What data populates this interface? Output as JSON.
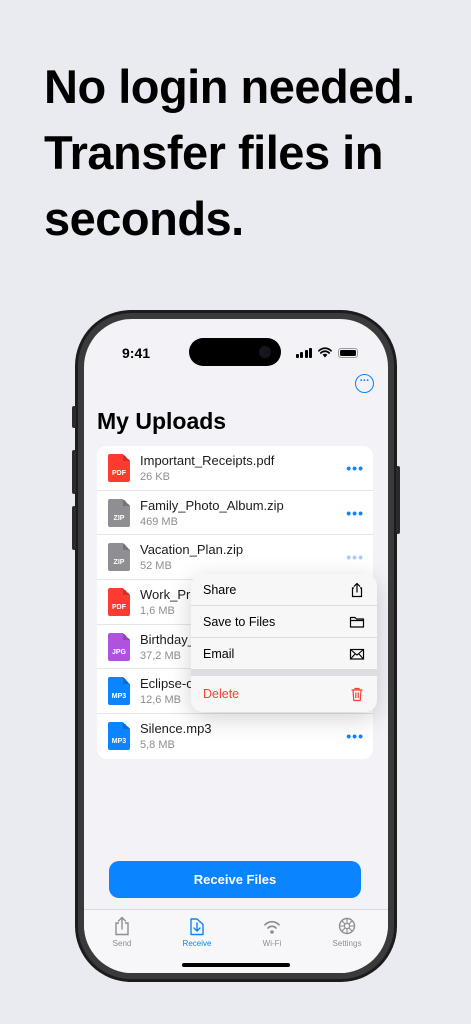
{
  "headline": {
    "line1": "No login needed.",
    "line2": "Transfer files in",
    "line3": "seconds."
  },
  "status_bar": {
    "time": "9:41"
  },
  "page": {
    "title": "My Uploads"
  },
  "files": [
    {
      "name": "Important_Receipts.pdf",
      "size": "26 KB",
      "type": "PDF",
      "color": "#ff3b30"
    },
    {
      "name": "Family_Photo_Album.zip",
      "size": "469 MB",
      "type": "ZIP",
      "color": "#8e8e93"
    },
    {
      "name": "Vacation_Plan.zip",
      "size": "52 MB",
      "type": "ZIP",
      "color": "#8e8e93"
    },
    {
      "name": "Work_Pro",
      "size": "1,6 MB",
      "type": "PDF",
      "color": "#ff3b30"
    },
    {
      "name": "Birthday_",
      "size": "37,2 MB",
      "type": "JPG",
      "color": "#af52de"
    },
    {
      "name": "Eclipse-o",
      "size": "12,6 MB",
      "type": "MP3",
      "color": "#0a84ff"
    },
    {
      "name": "Silence.mp3",
      "size": "5,8 MB",
      "type": "MP3",
      "color": "#0a84ff"
    }
  ],
  "context_menu": {
    "share": "Share",
    "save_to_files": "Save to Files",
    "email": "Email",
    "delete": "Delete"
  },
  "primary_button": {
    "label": "Receive Files"
  },
  "tabs": [
    {
      "label": "Send"
    },
    {
      "label": "Receive"
    },
    {
      "label": "Wi-Fi"
    },
    {
      "label": "Settings"
    }
  ],
  "colors": {
    "accent": "#0a84ff",
    "danger": "#ff3b30",
    "background": "#e9ebf1"
  },
  "icons": [
    "more-icon",
    "share-icon",
    "folder-icon",
    "envelope-icon",
    "trash-icon",
    "send-icon",
    "receive-icon",
    "wifi-icon",
    "gear-icon"
  ]
}
